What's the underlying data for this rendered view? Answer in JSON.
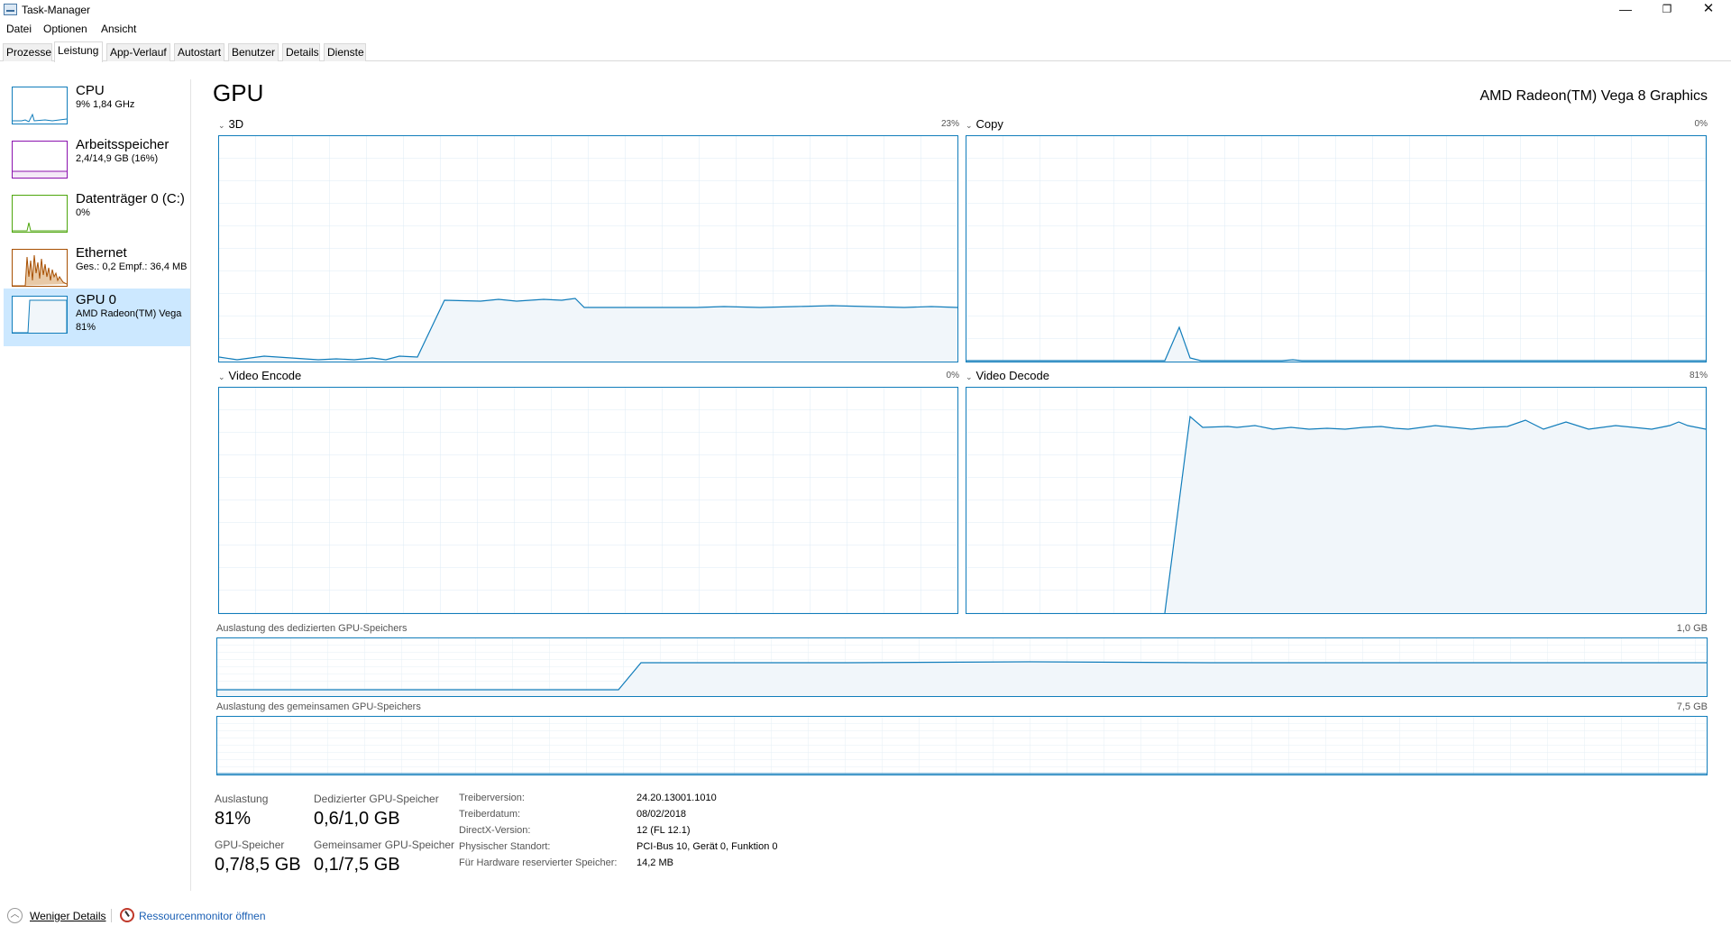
{
  "window": {
    "title": "Task-Manager",
    "minimize": "—",
    "maximize": "❐",
    "close": "✕"
  },
  "menu": [
    "Datei",
    "Optionen",
    "Ansicht"
  ],
  "tabs": [
    "Prozesse",
    "Leistung",
    "App-Verlauf",
    "Autostart",
    "Benutzer",
    "Details",
    "Dienste"
  ],
  "active_tab": "Leistung",
  "sidebar": [
    {
      "title": "CPU",
      "sub": "9%  1,84 GHz",
      "color": "#117dbb"
    },
    {
      "title": "Arbeitsspeicher",
      "sub": "2,4/14,9 GB (16%)",
      "color": "#8b12ae"
    },
    {
      "title": "Datenträger 0 (C:)",
      "sub": "0%",
      "color": "#4da60c"
    },
    {
      "title": "Ethernet",
      "sub": "Ges.: 0,2  Empf.: 36,4 MB",
      "color": "#a74f01"
    },
    {
      "title": "GPU 0",
      "sub": "AMD Radeon(TM) Vega",
      "sub2": "81%",
      "color": "#117dbb"
    }
  ],
  "main": {
    "title": "GPU",
    "gpu_name": "AMD Radeon(TM) Vega 8 Graphics",
    "graphs": [
      {
        "label": "3D",
        "pct": "23%"
      },
      {
        "label": "Copy",
        "pct": "0%"
      },
      {
        "label": "Video Encode",
        "pct": "0%"
      },
      {
        "label": "Video Decode",
        "pct": "81%"
      }
    ],
    "dedicated_label": "Auslastung des dedizierten GPU-Speichers",
    "dedicated_max": "1,0 GB",
    "shared_label": "Auslastung des gemeinsamen GPU-Speichers",
    "shared_max": "7,5 GB"
  },
  "stats": {
    "util_label": "Auslastung",
    "util_value": "81%",
    "ded_label": "Dedizierter GPU-Speicher",
    "ded_value": "0,6/1,0 GB",
    "gpumem_label": "GPU-Speicher",
    "gpumem_value": "0,7/8,5 GB",
    "shared_label": "Gemeinsamer GPU-Speicher",
    "shared_value": "0,1/7,5 GB"
  },
  "info": [
    {
      "label": "Treiberversion:",
      "value": "24.20.13001.1010"
    },
    {
      "label": "Treiberdatum:",
      "value": "08/02/2018"
    },
    {
      "label": "DirectX-Version:",
      "value": "12 (FL 12.1)"
    },
    {
      "label": "Physischer Standort:",
      "value": "PCI-Bus 10, Gerät 0, Funktion 0"
    },
    {
      "label": "Für Hardware reservierter Speicher:",
      "value": "14,2 MB"
    }
  ],
  "footer": {
    "fewer": "Weniger Details",
    "resmon": "Ressourcenmonitor öffnen"
  },
  "colors": {
    "accent": "#117dbb",
    "fill": "#f1f6fa",
    "selected": "#cce8ff"
  }
}
